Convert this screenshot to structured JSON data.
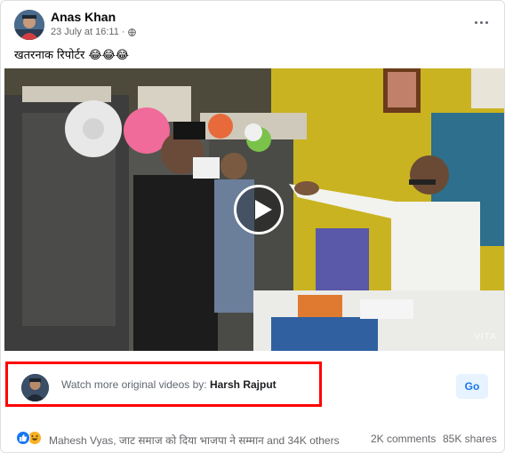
{
  "post": {
    "author": "Anas Khan",
    "date": "23 July at 16:11 · ",
    "privacy_icon": "globe-icon",
    "text": "खतरनाक रिपोर्टर 😂😂😂"
  },
  "video": {
    "watermark": "VITA"
  },
  "watch_more": {
    "prefix": "Watch more original videos by: ",
    "creator": "Harsh Rajput",
    "go_label": "Go"
  },
  "footer": {
    "reaction_summary": "Mahesh Vyas, जाट समाज को दिया भाजपा ने सम्मान and 34K others",
    "comments": "2K comments",
    "shares": "85K shares"
  },
  "colors": {
    "highlight_box": "#ff0000",
    "link_blue": "#1877f2",
    "secondary_text": "#65676b"
  }
}
